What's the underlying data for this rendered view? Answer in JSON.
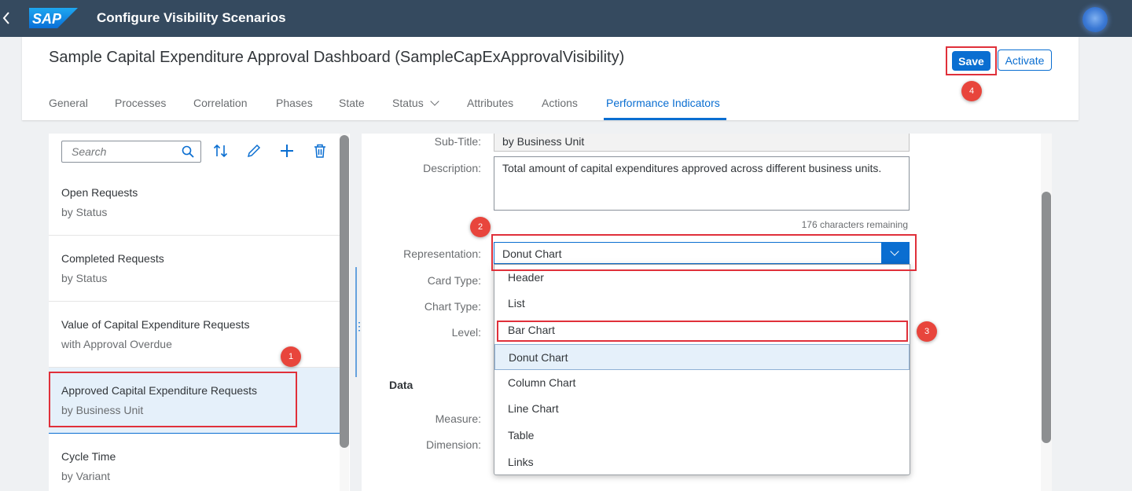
{
  "shell": {
    "title": "Configure Visibility Scenarios",
    "logo_text": "SAP",
    "back_icon": "chevron-left-icon"
  },
  "header": {
    "title": "Sample Capital Expenditure Approval Dashboard (SampleCapExApprovalVisibility)",
    "save_label": "Save",
    "activate_label": "Activate"
  },
  "tabs": [
    {
      "label": "General"
    },
    {
      "label": "Processes"
    },
    {
      "label": "Correlation"
    },
    {
      "label": "Phases"
    },
    {
      "label": "State"
    },
    {
      "label": "Status"
    },
    {
      "label": "Attributes"
    },
    {
      "label": "Actions"
    },
    {
      "label": "Performance Indicators",
      "selected": true
    }
  ],
  "list": {
    "search_placeholder": "Search",
    "items": [
      {
        "title": "Open Requests",
        "description": "by Status"
      },
      {
        "title": "Completed Requests",
        "description": "by Status"
      },
      {
        "title": "Value of Capital Expenditure Requests",
        "description": "with Approval Overdue"
      },
      {
        "title": "Approved Capital Expenditure Requests",
        "description": "by Business Unit",
        "selected": true
      },
      {
        "title": "Cycle Time",
        "description": "by Variant"
      }
    ]
  },
  "form": {
    "subtitle_label": "Sub-Title:",
    "subtitle_value": "by Business Unit",
    "description_label": "Description:",
    "description_value": "Total amount of capital expenditures approved across different business units.",
    "char_remaining": "176 characters remaining",
    "representation_label": "Representation:",
    "representation_value": "Donut Chart",
    "card_type_label": "Card Type:",
    "chart_type_label": "Chart Type:",
    "level_label": "Level:",
    "data_section_title": "Data",
    "measure_label": "Measure:",
    "dimension_label": "Dimension:"
  },
  "dropdown": {
    "options": [
      {
        "label": "Header"
      },
      {
        "label": "List"
      },
      {
        "label": "Bar Chart"
      },
      {
        "label": "Donut Chart",
        "selected": true
      },
      {
        "label": "Column Chart"
      },
      {
        "label": "Line Chart"
      },
      {
        "label": "Table"
      },
      {
        "label": "Links"
      }
    ]
  },
  "annotations": {
    "badge_1": "1",
    "badge_2": "2",
    "badge_3": "3",
    "badge_4": "4",
    "highlight_color": "#e0303a"
  },
  "colors": {
    "shell_bg": "#354a5f",
    "accent": "#0a6ed1",
    "selected_bg": "#e5f0fa"
  }
}
